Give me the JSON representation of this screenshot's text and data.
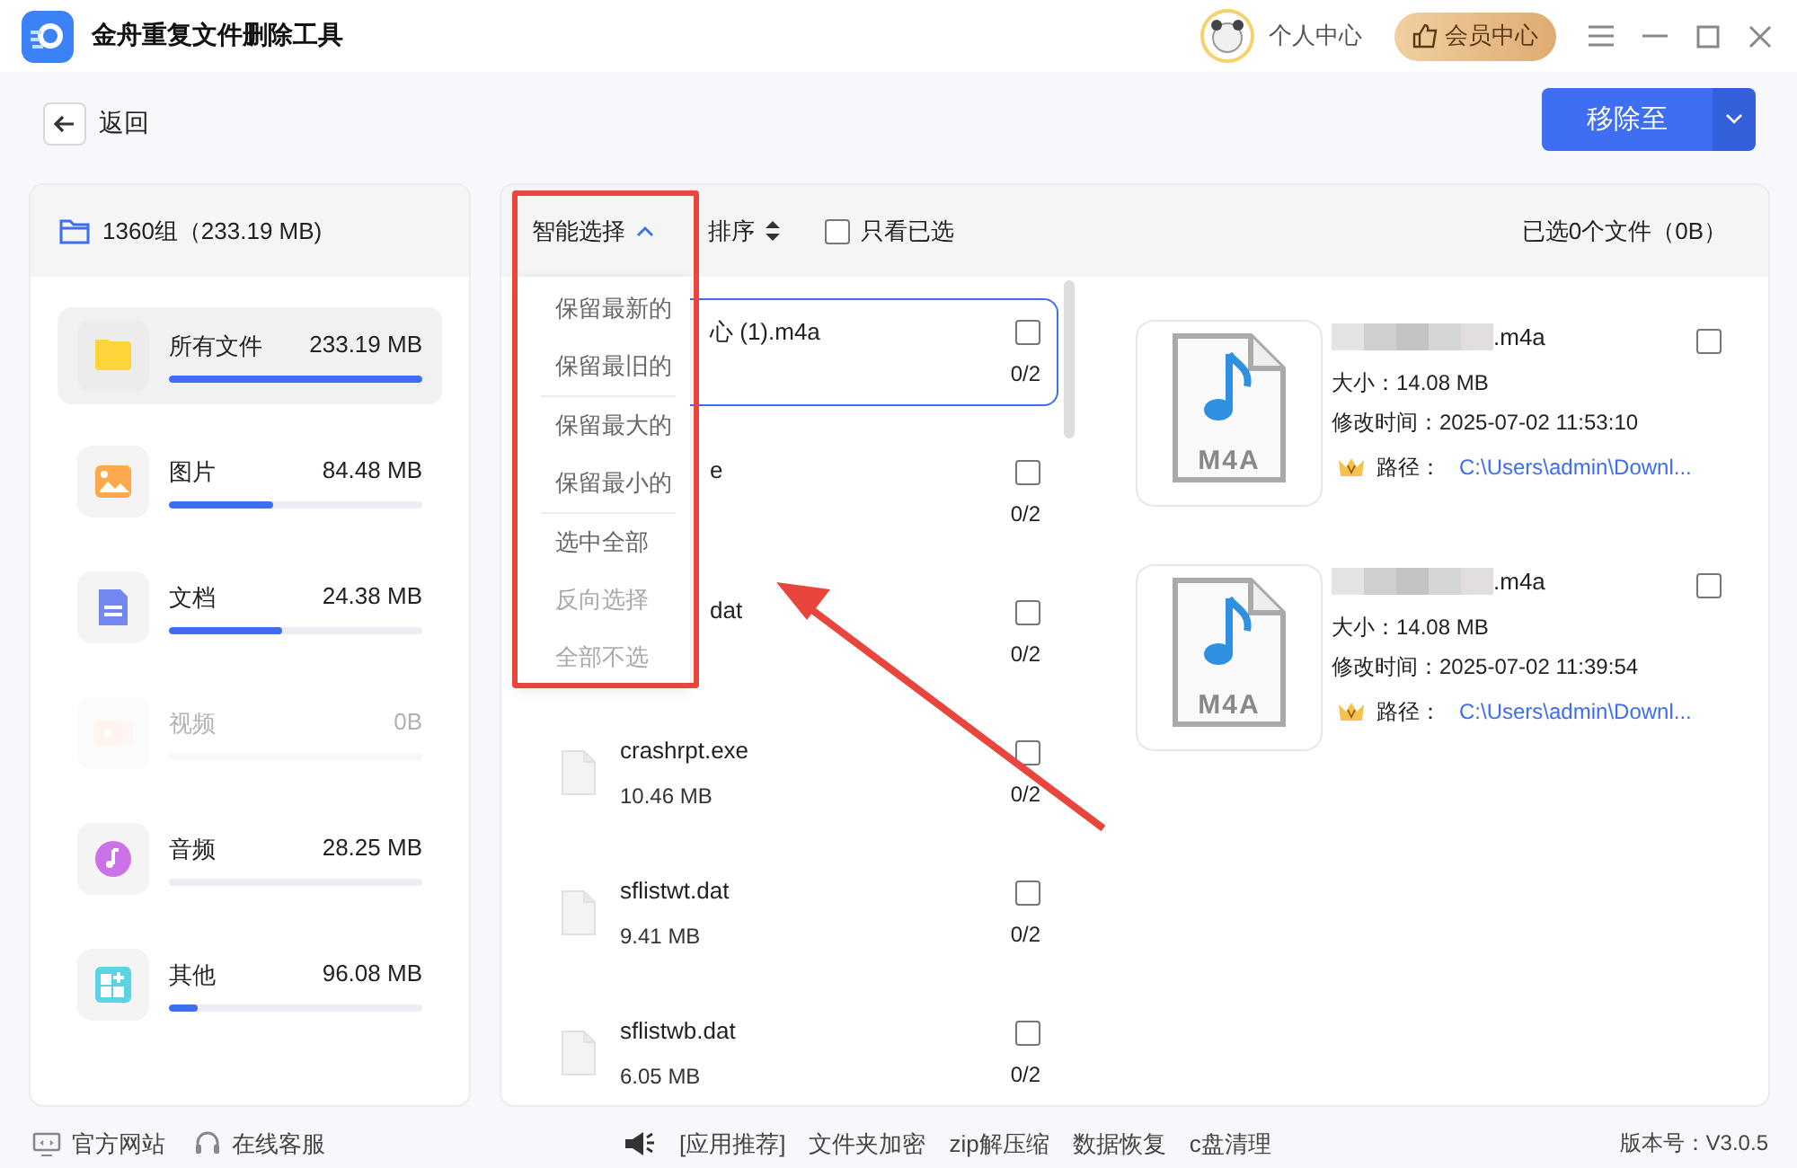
{
  "app": {
    "title": "金舟重复文件删除工具",
    "profile": "个人中心",
    "vip_button": "会员中心"
  },
  "toolbar": {
    "back": "返回",
    "move_button": "移除至"
  },
  "sidebar": {
    "summary": "1360组（233.19 MB)",
    "categories": [
      {
        "kind": "folder",
        "name": "所有文件",
        "size": "233.19 MB",
        "level": 1,
        "selected": true,
        "disabled": false
      },
      {
        "kind": "image",
        "name": "图片",
        "size": "84.48 MB",
        "level": 0.41,
        "selected": false,
        "disabled": false
      },
      {
        "kind": "document",
        "name": "文档",
        "size": "24.38 MB",
        "level": 0.45,
        "selected": false,
        "disabled": false
      },
      {
        "kind": "video",
        "name": "视频",
        "size": "0B",
        "level": 0,
        "selected": false,
        "disabled": true
      },
      {
        "kind": "audio",
        "name": "音频",
        "size": "28.25 MB",
        "level": 0,
        "selected": false,
        "disabled": false
      },
      {
        "kind": "other",
        "name": "其他",
        "size": "96.08 MB",
        "level": 0.11,
        "selected": false,
        "disabled": false
      }
    ]
  },
  "list": {
    "smart_select": "智能选择",
    "sort": "排序",
    "only_selected": {
      "label": "只看已选",
      "checked": false
    },
    "selected_summary": "已选0个文件（0B）",
    "menu_groups": [
      [
        {
          "label": "保留最新的",
          "disabled": false
        },
        {
          "label": "保留最旧的",
          "disabled": false
        }
      ],
      [
        {
          "label": "保留最大的",
          "disabled": false
        },
        {
          "label": "保留最小的",
          "disabled": false
        }
      ],
      [
        {
          "label": "选中全部",
          "disabled": false
        },
        {
          "label": "反向选择",
          "disabled": true
        },
        {
          "label": "全部不选",
          "disabled": true
        }
      ]
    ],
    "rows": [
      {
        "name": "心 (1).m4a",
        "count": "0/2",
        "checked": false,
        "selected": true
      },
      {
        "name": "e",
        "count": "0/2",
        "checked": false,
        "selected": false
      },
      {
        "name": "dat",
        "count": "0/2",
        "checked": false,
        "selected": false
      },
      {
        "name": "crashrpt.exe",
        "size": "10.46 MB",
        "count": "0/2",
        "checked": false,
        "selected": false
      },
      {
        "name": "sflistwt.dat",
        "size": "9.41 MB",
        "count": "0/2",
        "checked": false,
        "selected": false
      },
      {
        "name": "sflistwb.dat",
        "size": "6.05 MB",
        "count": "0/2",
        "checked": false,
        "selected": false
      }
    ]
  },
  "details": [
    {
      "thumb_label": "M4A",
      "name": ".m4a",
      "size": "大小：14.08 MB",
      "modified": "修改时间：2025-07-02 11:53:10",
      "path_label": "路径：",
      "path": "C:\\Users\\admin\\Downl...",
      "checked": false
    },
    {
      "thumb_label": "M4A",
      "name": ".m4a",
      "size": "大小：14.08 MB",
      "modified": "修改时间：2025-07-02 11:39:54",
      "path_label": "路径：",
      "path": "C:\\Users\\admin\\Downl...",
      "checked": false
    }
  ],
  "footer": {
    "links": [
      {
        "kind": "site",
        "label": "官方网站"
      },
      {
        "kind": "support",
        "label": "在线客服"
      }
    ],
    "promo_label": "[应用推荐]",
    "promos": [
      "文件夹加密",
      "zip解压缩",
      "数据恢复",
      "c盘清理"
    ],
    "version": "版本号：V3.0.5"
  }
}
